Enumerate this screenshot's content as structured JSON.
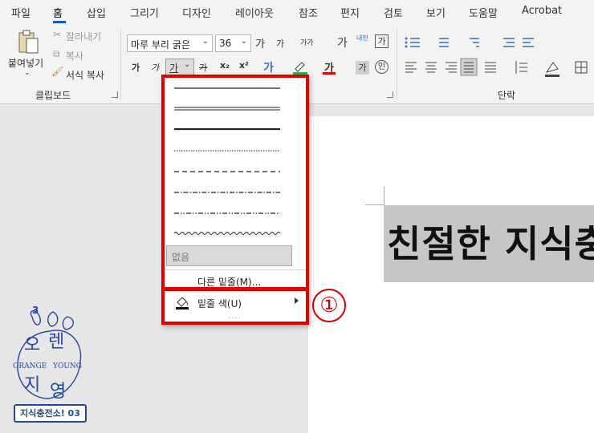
{
  "menu": {
    "tabs": [
      {
        "label": "파일"
      },
      {
        "label": "홈"
      },
      {
        "label": "삽입"
      },
      {
        "label": "그리기"
      },
      {
        "label": "디자인"
      },
      {
        "label": "레이아웃"
      },
      {
        "label": "참조"
      },
      {
        "label": "편지"
      },
      {
        "label": "검토"
      },
      {
        "label": "보기"
      },
      {
        "label": "도움말"
      },
      {
        "label": "Acrobat"
      }
    ]
  },
  "clipboard": {
    "paste_label": "붙여넣기",
    "cut_label": "잘라내기",
    "copy_label": "복사",
    "format_painter_label": "서식 복사",
    "group_label": "클립보드"
  },
  "font": {
    "font_name": "마루 부리 굵은",
    "font_size": "36",
    "grow_label": "가",
    "shrink_label": "가",
    "case_label": "가가",
    "clear_label": "가",
    "phonetic_label": "내천",
    "border_label": "가",
    "bold_label": "가",
    "italic_label": "가",
    "underline_label": "가",
    "strike_label": "가",
    "subscript_label": "x₂",
    "superscript_label": "x²",
    "effects_label": "가",
    "color_label": "가",
    "shading_label": "가",
    "enclosed_label": "인"
  },
  "paragraph": {
    "group_label": "단락"
  },
  "document": {
    "selected_text": "친절한 지식충"
  },
  "underline_menu": {
    "none_label": "없음",
    "more_label": "다른 밑줄(M)...",
    "color_label": "밑줄 색(U)",
    "grip": "....",
    "callout": "①"
  },
  "logo": {
    "number": "3",
    "char_o": "오",
    "char_ren": "렌",
    "char_ji": "지",
    "char_young": "영",
    "orange": "ORANGE",
    "young": "YOUNG",
    "badge": "지식충전소! 03"
  },
  "colors": {
    "accent": "#185abd",
    "highlight_red": "#e00000",
    "logo_blue": "#24479a",
    "font_color_red": "#e00000",
    "highlight_green": "#22b14c"
  }
}
